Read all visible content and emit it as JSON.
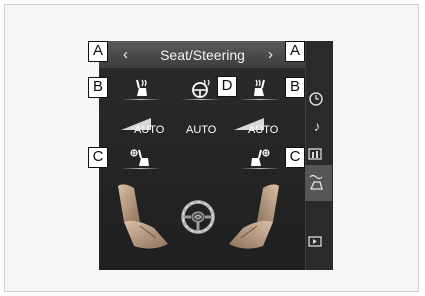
{
  "header": {
    "title": "Seat/Steering",
    "prev_arrow": "‹",
    "next_arrow": "›"
  },
  "callouts": {
    "top_left": "A",
    "top_right": "A",
    "heat_left": "B",
    "heat_right": "B",
    "vent_left": "C",
    "vent_right": "C",
    "steering": "D"
  },
  "auto_labels": {
    "left": "AUTO",
    "center": "AUTO",
    "right": "AUTO"
  },
  "icons": {
    "seat_heater_left": "seat-heater-icon",
    "steering_heater": "steering-heater-icon",
    "seat_heater_right": "seat-heater-icon",
    "seat_vent_left": "seat-ventilator-icon",
    "seat_vent_right": "seat-ventilator-icon",
    "level_left": "level-bars-icon",
    "level_right": "level-bars-icon",
    "driver_seat": "seat-image",
    "passenger_seat": "seat-image",
    "steering_wheel": "steering-wheel-image",
    "sidebar": [
      "clock-icon",
      "music-icon",
      "grid-icon",
      "seat-climate-icon",
      "screen-icon"
    ]
  },
  "colors": {
    "screen_bg": "#222222",
    "topbar_bg": "#4a4a4a",
    "seat_tan": "#b99a80",
    "sidebar_highlight": "#565656"
  }
}
